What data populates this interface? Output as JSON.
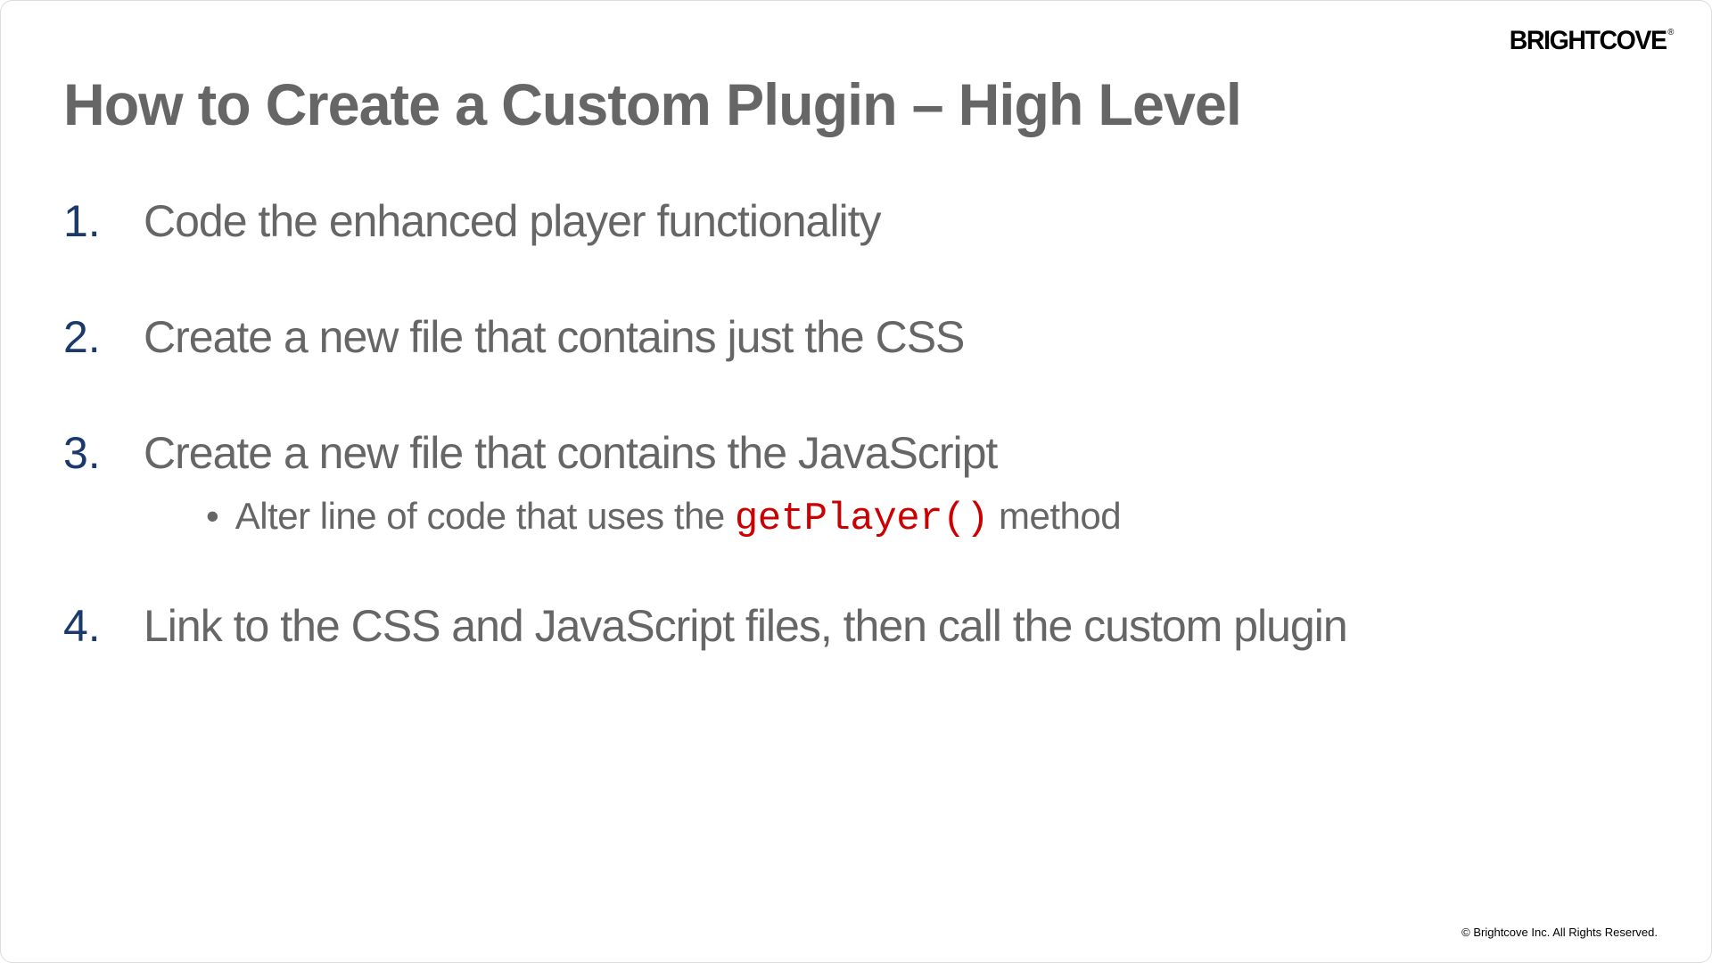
{
  "logo": "BRIGHTCOVE",
  "title": "How to Create a Custom Plugin – High Level",
  "items": [
    {
      "num": "1.",
      "text": "Code the enhanced player functionality"
    },
    {
      "num": "2.",
      "text": "Create a new file that contains just the CSS"
    },
    {
      "num": "3.",
      "text": "Create a new file that contains the JavaScript"
    },
    {
      "num": "4.",
      "text": "Link to the CSS and JavaScript files, then call the custom plugin"
    }
  ],
  "sub": {
    "prefix": "Alter line of code that uses the ",
    "code": "getPlayer()",
    "suffix": " method"
  },
  "copyright": "© Brightcove Inc. All Rights Reserved."
}
